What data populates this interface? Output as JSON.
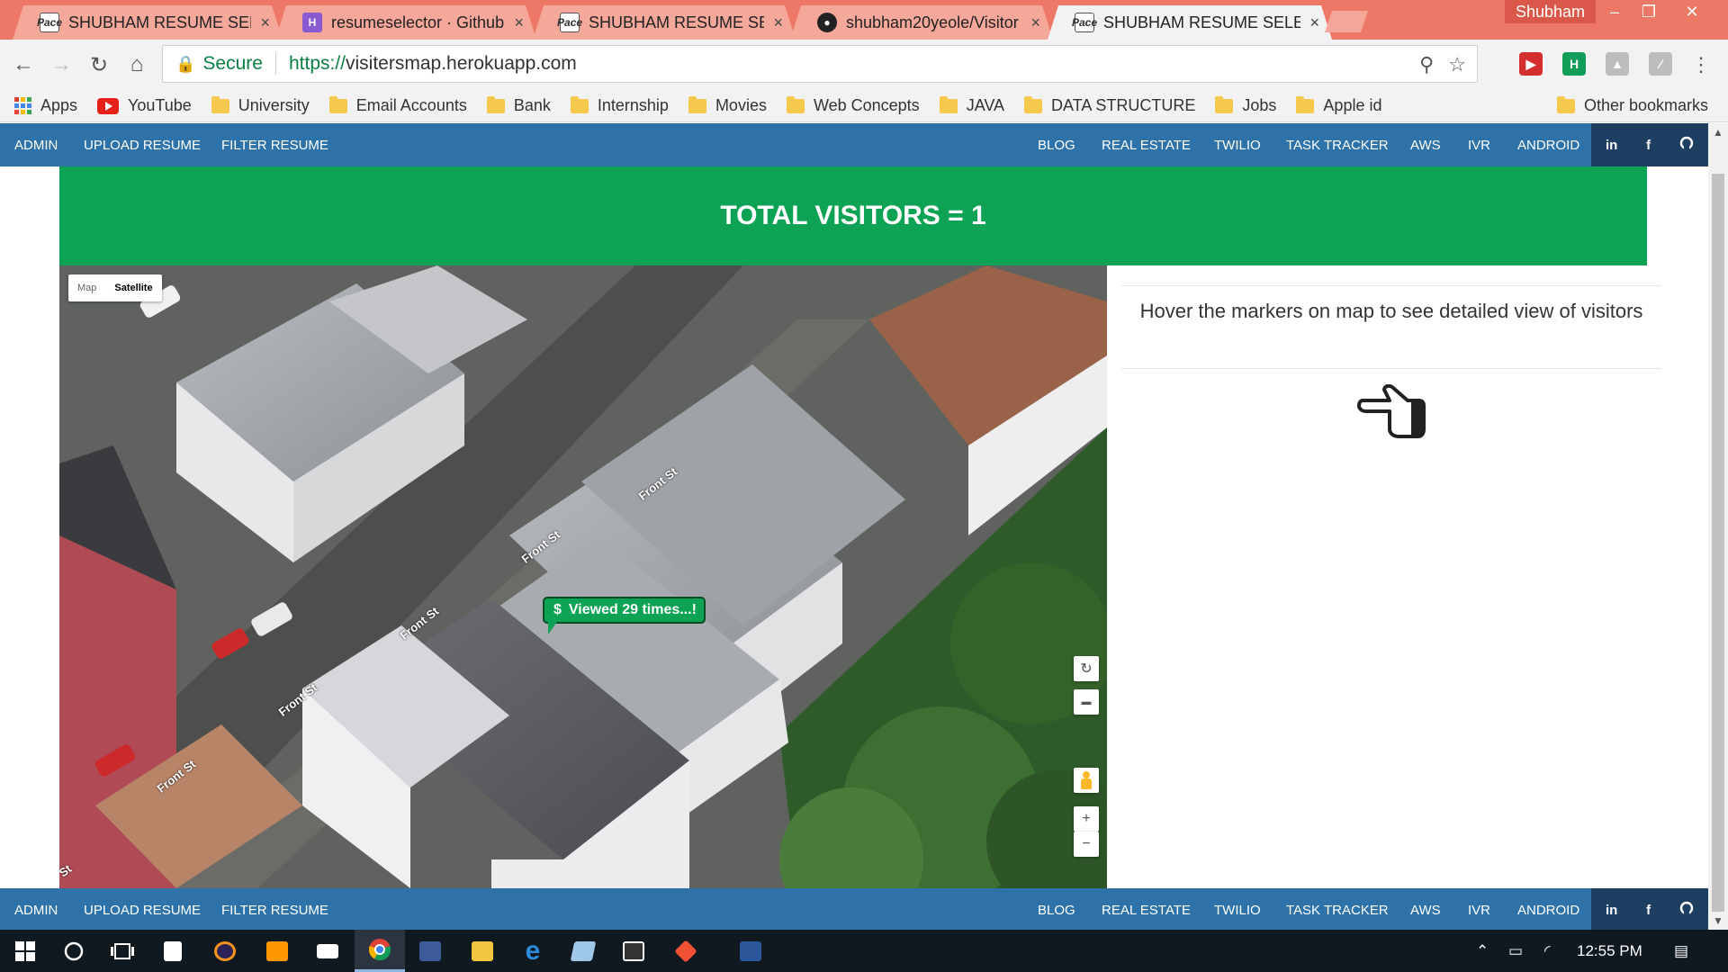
{
  "browser": {
    "tabs": [
      {
        "label": "SHUBHAM RESUME SELE",
        "favicon": "pace-icon"
      },
      {
        "label": "resumeselector · Github |",
        "favicon": "h-icon"
      },
      {
        "label": "SHUBHAM RESUME SELE",
        "favicon": "pace-icon"
      },
      {
        "label": "shubham20yeole/Visitor",
        "favicon": "github-icon"
      },
      {
        "label": "SHUBHAM RESUME SELE",
        "favicon": "pace-icon"
      }
    ],
    "active_tab_index": 4,
    "tab_close_glyph": "×",
    "profile_name": "Shubham",
    "security_label": "Secure",
    "url_scheme": "https://",
    "url_host": "visitersmap.herokuapp.com"
  },
  "bookmarks": {
    "items": [
      "Apps",
      "YouTube",
      "University",
      "Email Accounts",
      "Bank",
      "Internship",
      "Movies",
      "Web Concepts",
      "JAVA",
      "DATA STRUCTURE",
      "Jobs",
      "Apple id"
    ],
    "other": "Other bookmarks"
  },
  "site_nav": {
    "left": [
      "ADMIN",
      "UPLOAD RESUME",
      "FILTER RESUME"
    ],
    "right": [
      "BLOG",
      "REAL ESTATE",
      "TWILIO",
      "TASK TRACKER",
      "AWS",
      "IVR",
      "ANDROID"
    ],
    "social": [
      "in",
      "f",
      "github-icon"
    ]
  },
  "banner": {
    "text": "TOTAL VISITORS = 1",
    "color": "#0ea254"
  },
  "map": {
    "type_options": [
      "Map",
      "Satellite"
    ],
    "selected_type": "Satellite",
    "marker_text": "Viewed 29 times...!",
    "marker_icon": "$",
    "street_labels": [
      "Front St",
      "Front St",
      "Front St",
      "Front St",
      "Front St",
      "St"
    ],
    "zoom_in": "+",
    "zoom_out": "−"
  },
  "info_panel": {
    "text": "Hover the markers on map to see detailed view of visitors",
    "icon": "pointing-hand-icon"
  },
  "taskbar": {
    "time": "12:55 PM"
  },
  "colors": {
    "tab_strip": "#ee7866",
    "nav_bar": "#2d72a8",
    "social_block": "#1d3f62",
    "banner": "#0ea254"
  }
}
